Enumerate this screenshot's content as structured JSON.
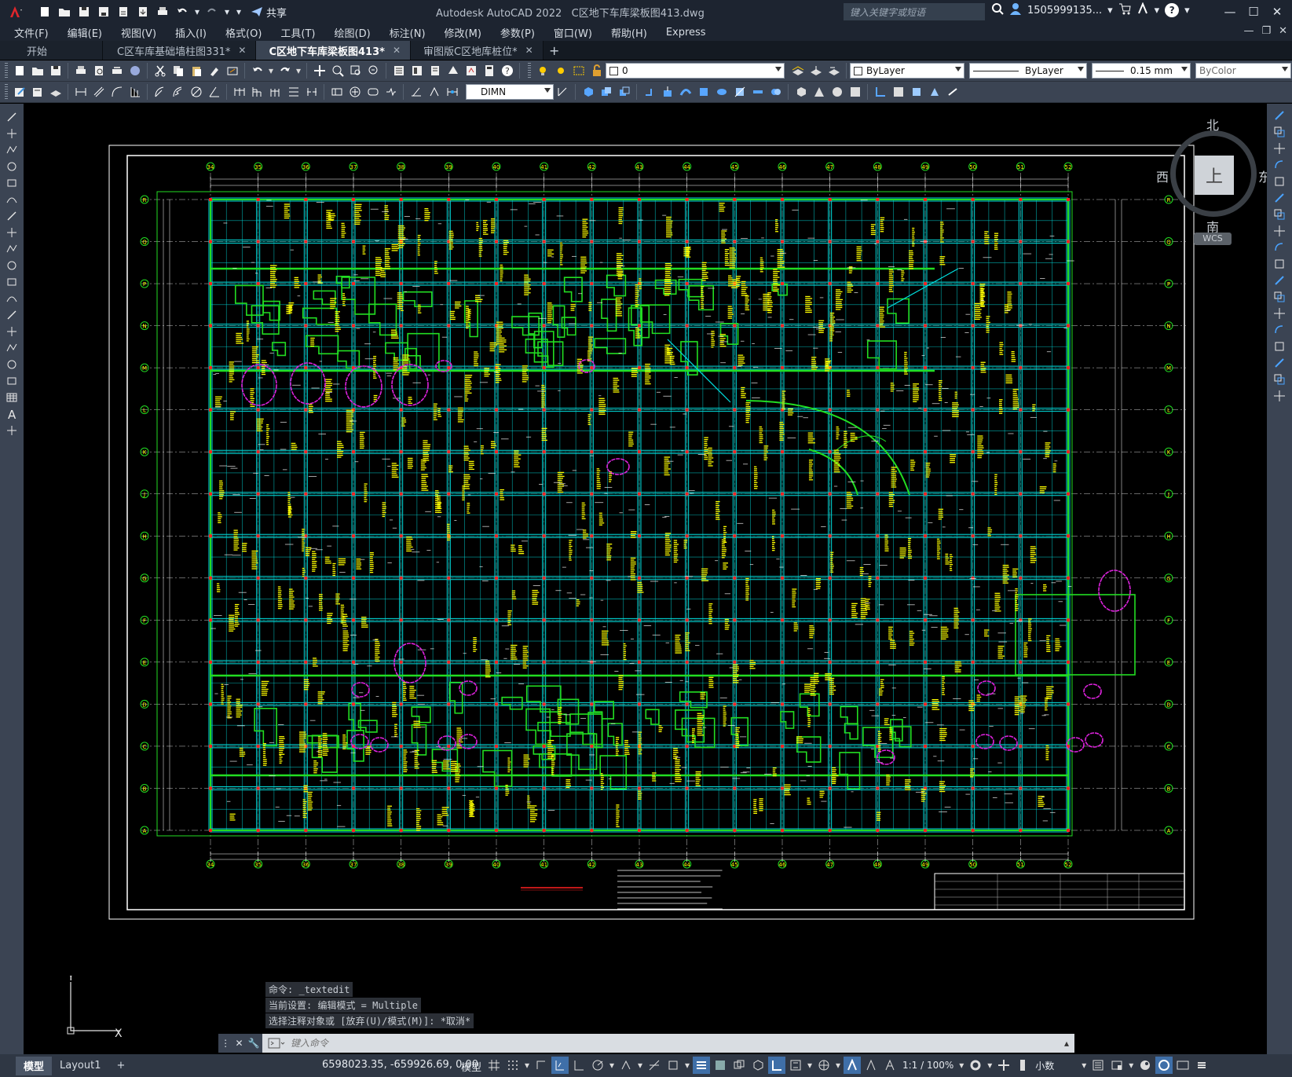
{
  "titlebar": {
    "app_title": "Autodesk AutoCAD 2022",
    "doc_title": "C区地下车库梁板图413.dwg",
    "share_label": "共享",
    "search_placeholder": "键入关键字或短语",
    "user_name": "1505999135...",
    "help_label": "?"
  },
  "menu": {
    "items": [
      "文件(F)",
      "编辑(E)",
      "视图(V)",
      "插入(I)",
      "格式(O)",
      "工具(T)",
      "绘图(D)",
      "标注(N)",
      "修改(M)",
      "参数(P)",
      "窗口(W)",
      "帮助(H)",
      "Express"
    ]
  },
  "tabs": {
    "items": [
      {
        "label": "开始",
        "closable": false,
        "active": false
      },
      {
        "label": "C区车库基础墙柱图331*",
        "closable": true,
        "active": false
      },
      {
        "label": "C区地下车库梁板图413*",
        "closable": true,
        "active": true
      },
      {
        "label": "审图版C区地库桩位*",
        "closable": true,
        "active": false
      }
    ],
    "add_label": "+"
  },
  "toolbar": {
    "layer_value": "0",
    "color_value": "ByLayer",
    "linetype_value": "ByLayer",
    "lineweight_value": "0.15 mm",
    "plotstyle_value": "ByColor",
    "dimstyle_value": "DIMN"
  },
  "viewcube": {
    "north": "北",
    "south": "南",
    "east": "东",
    "west": "西",
    "top_face": "上",
    "wcs": "WCS"
  },
  "ucs": {
    "x_label": "X",
    "y_label": "Y"
  },
  "command": {
    "history": [
      "命令: _textedit",
      "当前设置: 编辑模式 = Multiple",
      "选择注释对象或 [放弃(U)/模式(M)]: *取消*"
    ],
    "placeholder": "键入命令"
  },
  "statusbar": {
    "model_tab": "模型",
    "layout_tab": "Layout1",
    "add_layout": "+",
    "coords": "6598023.35, -659926.69, 0.00",
    "space_label": "模型",
    "scale_label": "1:1 / 100%",
    "units_label": "小数"
  },
  "drawing": {
    "col_labels": [
      "34",
      "35",
      "36",
      "37",
      "38",
      "39",
      "40",
      "41",
      "42",
      "43",
      "44",
      "45",
      "46",
      "47",
      "48",
      "49",
      "50",
      "51",
      "52"
    ],
    "row_labels": [
      "R",
      "Q",
      "P",
      "N",
      "M",
      "L",
      "K",
      "J",
      "H",
      "G",
      "F",
      "E",
      "D",
      "C",
      "B",
      "A"
    ],
    "colors": {
      "grid": "#00e0e0",
      "wall": "#22dd22",
      "text": "#ffff00",
      "cloud": "#dd22dd",
      "dim": "#ffffff",
      "axis": "#cccccc",
      "column": "#ff2020"
    }
  }
}
